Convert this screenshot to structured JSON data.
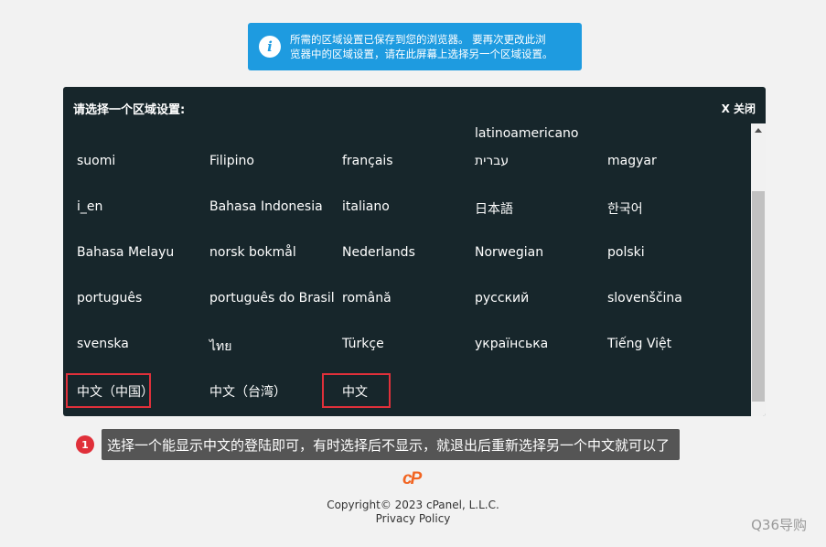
{
  "notice": {
    "icon": "info-icon",
    "line1": "所需的区域设置已保存到您的浏览器。 要再次更改此浏",
    "line2": "览器中的区域设置，请在此屏幕上选择另一个区域设置。"
  },
  "dialog": {
    "title": "请选择一个区域设置:",
    "close_label": "X 关闭"
  },
  "languages": [
    [
      "",
      "",
      "",
      "latinoamericano",
      ""
    ],
    [
      "suomi",
      "Filipino",
      "français",
      "עברית",
      "magyar"
    ],
    [
      "i_en",
      "Bahasa Indonesia",
      "italiano",
      "日本語",
      "한국어"
    ],
    [
      "Bahasa Melayu",
      "norsk bokmål",
      "Nederlands",
      "Norwegian",
      "polski"
    ],
    [
      "português",
      "português do Brasil",
      "română",
      "русский",
      "slovenščina"
    ],
    [
      "svenska",
      "ไทย",
      "Türkçe",
      "українська",
      "Tiếng Việt"
    ],
    [
      "中文（中国）",
      "中文（台湾）",
      "中文",
      "",
      ""
    ]
  ],
  "annotation": {
    "number": "1",
    "text": "选择一个能显示中文的登陆即可，有时选择后不显示，就退出后重新选择另一个中文就可以了"
  },
  "footer": {
    "logo": "cP",
    "copyright": "Copyright© 2023 cPanel, L.L.C.",
    "privacy": "Privacy Policy"
  },
  "watermark": "Q36导购",
  "colors": {
    "notice_bg": "#1e9be0",
    "dialog_bg": "#17262b",
    "highlight": "#e0303a",
    "brand": "#f26522"
  }
}
